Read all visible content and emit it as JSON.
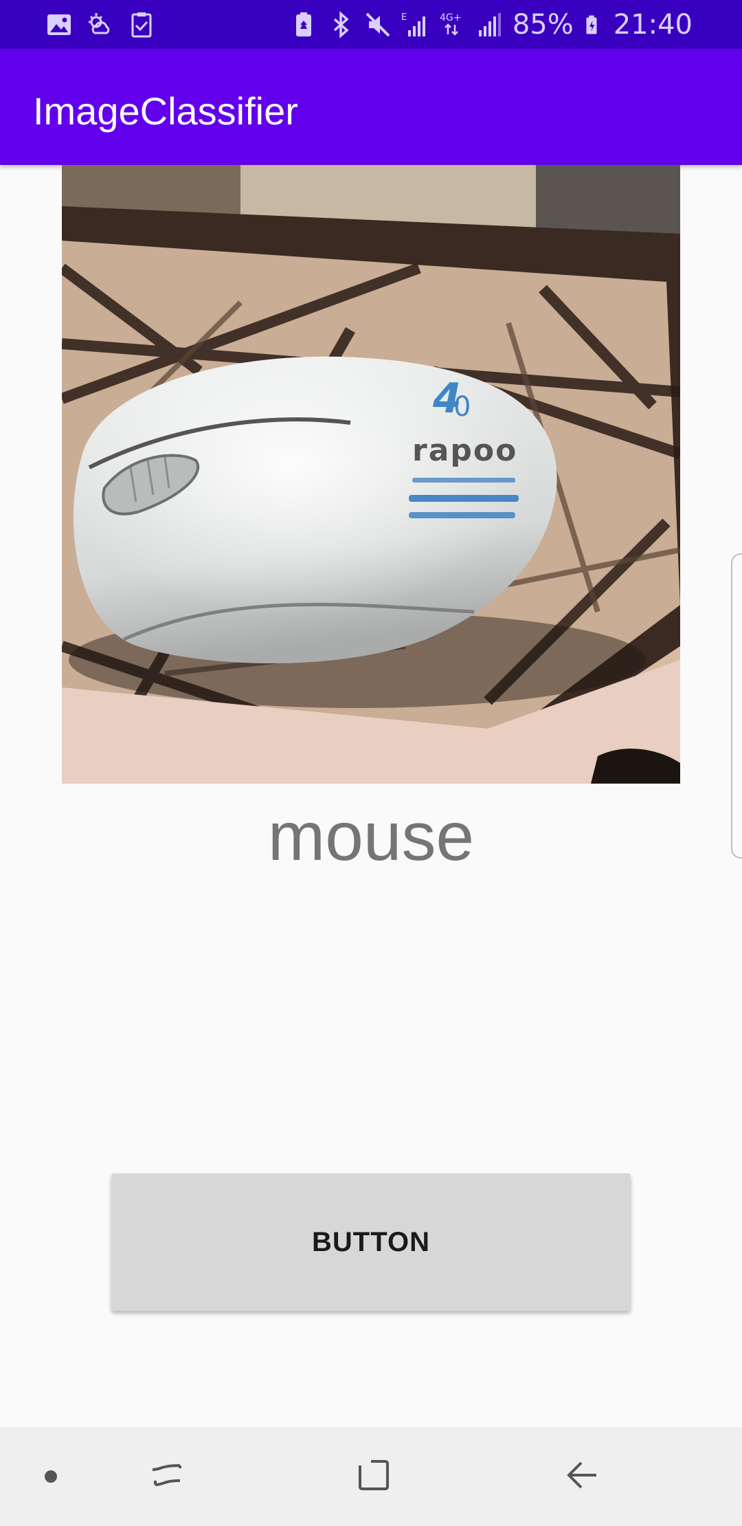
{
  "status_bar": {
    "left_icons": [
      "image-icon",
      "weather-icon",
      "task-check-icon"
    ],
    "right_icons": [
      "battery-saver-icon",
      "bluetooth-icon",
      "mute-icon",
      "signal-e-icon",
      "signal-4g-icon",
      "signal-icon",
      "battery-icon"
    ],
    "battery": "85%",
    "time": "21:40",
    "color": "#3a00c0"
  },
  "app_bar": {
    "title": "ImageClassifier",
    "color": "#6200ee"
  },
  "main": {
    "image_name": "mouse-photo",
    "brand_text": "rapoo",
    "result": "mouse",
    "button_label": "BUTTON"
  },
  "nav_bar": {
    "icons": [
      "dot-icon",
      "recents-icon",
      "home-icon",
      "back-icon"
    ]
  }
}
